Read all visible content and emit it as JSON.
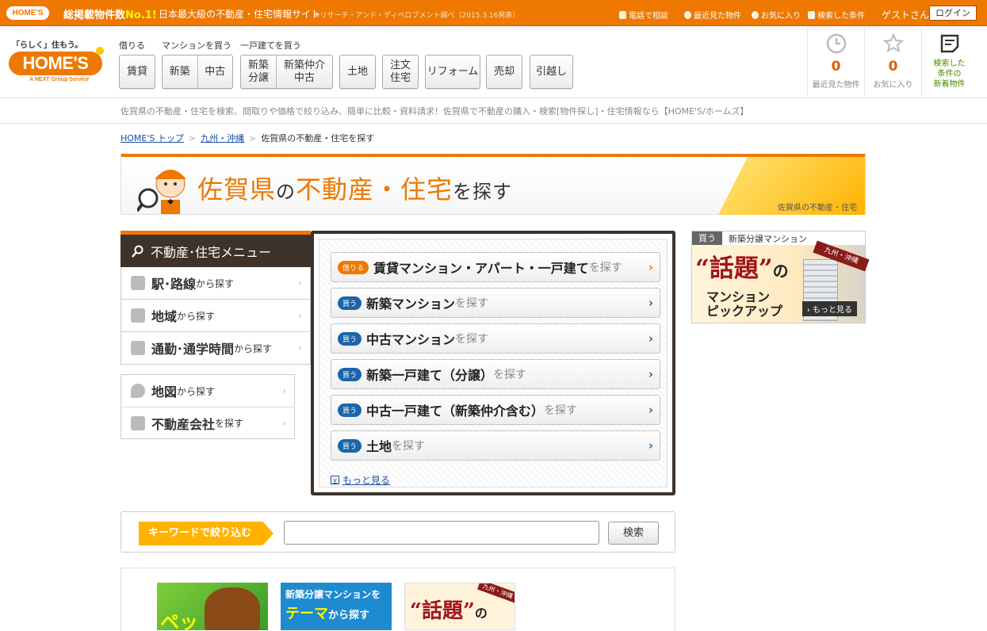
{
  "topbar": {
    "logo": "HOME'S",
    "tagline_prefix": "総掲載物件数",
    "tagline_highlight": "No.1!",
    "tagline_main": "日本最大級の不動産・住宅情報サイト",
    "tagline_note": "※リサーチ・アンド・ディベロプメント調べ（2015.3.16発表）",
    "links": [
      "電話で相談",
      "最近見た物件",
      "お気に入り",
      "検索した条件"
    ],
    "guest": "ゲストさん",
    "login": "ログイン"
  },
  "brand": {
    "tagline": "「らしく」住もう。",
    "name": "HOME'S",
    "sub": "A NEXT Group Service"
  },
  "nav": {
    "groups": [
      "借りる",
      "マンションを買う",
      "一戸建てを買う"
    ],
    "rent": "賃貸",
    "mansion_new": "新築",
    "mansion_used": "中古",
    "house_new_line1": "新築",
    "house_new_line2": "分譲",
    "house_brokered_line1": "新築仲介",
    "house_brokered_line2": "中古",
    "land": "土地",
    "custom_line1": "注文",
    "custom_line2": "住宅",
    "reform": "リフォーム",
    "sell": "売却",
    "moving": "引越し"
  },
  "stats": {
    "recent_count": "0",
    "recent_label": "最近見た物件",
    "fav_count": "0",
    "fav_label": "お気に入り",
    "new_line1": "検索した",
    "new_line2": "条件の",
    "new_line3": "新着物件"
  },
  "description": "佐賀県の不動産・住宅を検索、間取りや価格で絞り込み、簡単に比較・資料請求！佐賀県で不動産の購入・検索[物件探し]・住宅情報なら【HOME'S/ホームズ】",
  "breadcrumb": [
    "HOME'S トップ",
    "九州・沖縄",
    "佐賀県の不動産・住宅を探す"
  ],
  "banner": {
    "pref": "佐賀県",
    "no": "の",
    "mid": "不動産・住宅",
    "tail": "を探す",
    "caption": "佐賀県の不動産・住宅"
  },
  "sidemenu": {
    "title": "不動産･住宅メニュー",
    "items": [
      {
        "big": "駅･路線",
        "small": "から探す"
      },
      {
        "big": "地域",
        "small": "から探す"
      },
      {
        "big": "通勤･通学時間",
        "small": "から探す"
      }
    ],
    "items2": [
      {
        "big": "地図",
        "small": "から探す"
      },
      {
        "big": "不動産会社",
        "small": "を探す"
      }
    ]
  },
  "properties": [
    {
      "badge": "借りる",
      "title": "賃貸マンション・アパート・一戸建て",
      "suffix": "を探す"
    },
    {
      "badge": "買う",
      "title": "新築マンション",
      "suffix": "を探す"
    },
    {
      "badge": "買う",
      "title": "中古マンション",
      "suffix": "を探す"
    },
    {
      "badge": "買う",
      "title": "新築一戸建て（分譲）",
      "suffix": "を探す"
    },
    {
      "badge": "買う",
      "title": "中古一戸建て（新築仲介含む）",
      "suffix": "を探す"
    },
    {
      "badge": "買う",
      "title": "土地",
      "suffix": "を探す"
    }
  ],
  "more": "もっと見る",
  "ad": {
    "buy": "買う",
    "label": "新築分譲マンション",
    "quote": "“話題”",
    "no": "の",
    "line2": "マンション",
    "line3": "ピックアップ",
    "ribbon": "九州・沖縄",
    "more": "もっと見る"
  },
  "keyword": {
    "label": "キーワードで絞り込む",
    "placeholder": "",
    "button": "検索"
  },
  "bottom": {
    "t1": "ペッ",
    "t2a": "新築分譲マンションを",
    "t2b": "テーマ",
    "t2c": "から探す",
    "t3": "“話題”",
    "t3no": "の",
    "t3rib": "九州・沖縄"
  }
}
